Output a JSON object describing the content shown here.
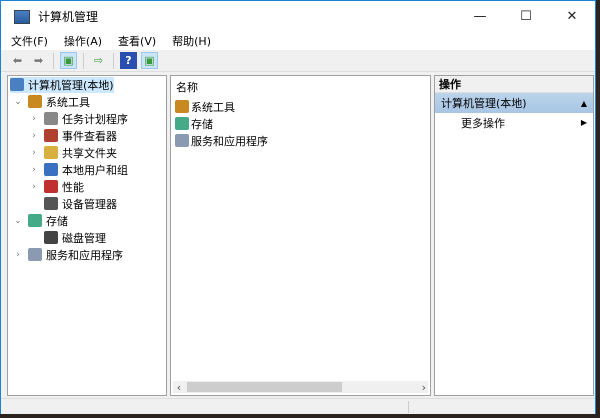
{
  "window": {
    "title": "计算机管理",
    "min": "—",
    "max": "☐",
    "close": "✕"
  },
  "menu": [
    "文件(F)",
    "操作(A)",
    "查看(V)",
    "帮助(H)"
  ],
  "tree": {
    "root": "计算机管理(本地)",
    "items": [
      {
        "label": "系统工具",
        "level": 1,
        "exp": "⌄",
        "color": "#c88a20"
      },
      {
        "label": "任务计划程序",
        "level": 2,
        "exp": "›",
        "color": "#888"
      },
      {
        "label": "事件查看器",
        "level": 2,
        "exp": "›",
        "color": "#b04030"
      },
      {
        "label": "共享文件夹",
        "level": 2,
        "exp": "›",
        "color": "#d8b040"
      },
      {
        "label": "本地用户和组",
        "level": 2,
        "exp": "›",
        "color": "#3a70c0"
      },
      {
        "label": "性能",
        "level": 2,
        "exp": "›",
        "color": "#c03030"
      },
      {
        "label": "设备管理器",
        "level": 2,
        "exp": "",
        "color": "#555"
      },
      {
        "label": "存储",
        "level": 1,
        "exp": "⌄",
        "color": "#4a8"
      },
      {
        "label": "磁盘管理",
        "level": 2,
        "exp": "",
        "color": "#444"
      },
      {
        "label": "服务和应用程序",
        "level": 1,
        "exp": "›",
        "color": "#8a9ab0"
      }
    ]
  },
  "list": {
    "header": "名称",
    "items": [
      {
        "label": "系统工具",
        "color": "#c88a20"
      },
      {
        "label": "存储",
        "color": "#4a8"
      },
      {
        "label": "服务和应用程序",
        "color": "#8a9ab0"
      }
    ]
  },
  "actions": {
    "header": "操作",
    "section": "计算机管理(本地)",
    "more": "更多操作"
  }
}
